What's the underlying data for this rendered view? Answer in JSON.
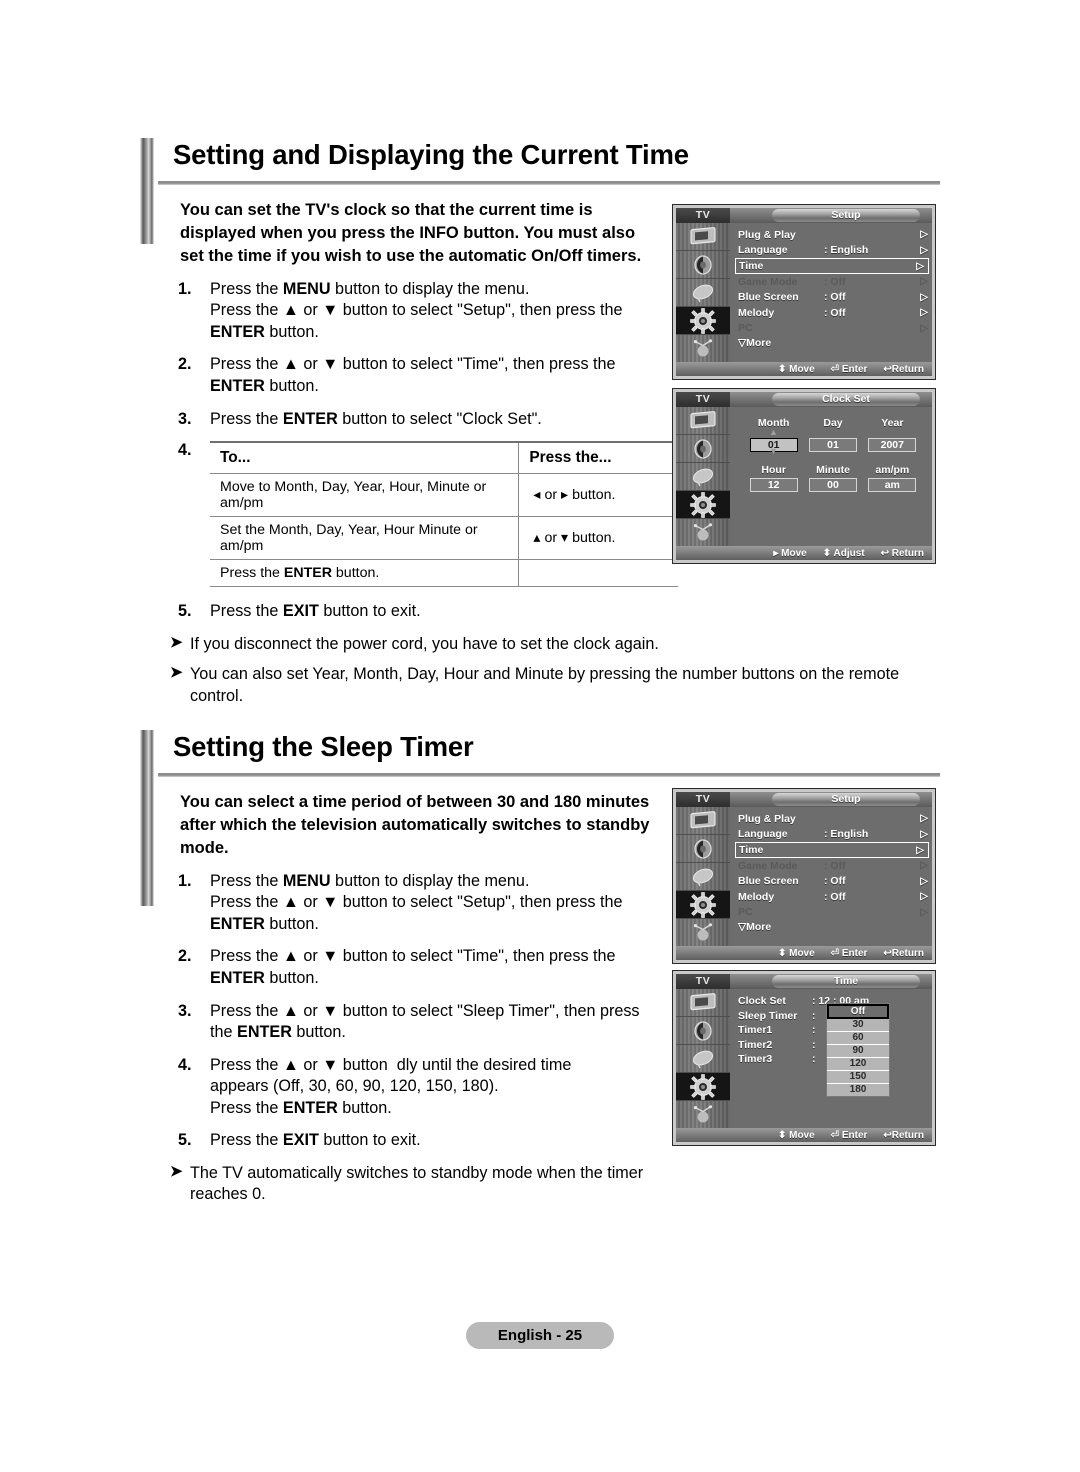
{
  "page": {
    "footer_label": "English - 25"
  },
  "section1": {
    "heading": "Setting and Displaying the Current Time",
    "intro": "You can set the TV's clock so that the current time is displayed when you press the INFO button. You must also set the time if you wish to use the automatic On/Off timers.",
    "steps": [
      {
        "num": "1.",
        "lines": [
          "Press the MENU button to display the menu.",
          "Press the ▲ or ▼ button to select \"Setup\", then press the ENTER button."
        ]
      },
      {
        "num": "2.",
        "lines": [
          "Press the ▲ or ▼ button to select \"Time\", then press the ENTER button."
        ]
      },
      {
        "num": "3.",
        "lines": [
          "Press the ENTER button to select \"Clock Set\"."
        ]
      }
    ],
    "table": {
      "num": "4.",
      "headers": [
        "To...",
        "Press the..."
      ],
      "rows": [
        [
          "Move to Month, Day, Year, Hour, Minute or am/pm",
          "◂  or  ▸  button."
        ],
        [
          "Set the Month, Day, Year, Hour Minute or am/pm",
          "▴  or  ▾  button."
        ],
        [
          "Press the ENTER button.",
          ""
        ]
      ]
    },
    "step5": {
      "num": "5.",
      "text": "Press the EXIT button to exit."
    },
    "notes": [
      "If you disconnect the power cord, you have to set the clock again.",
      "You can also set Year, Month, Day, Hour and Minute by pressing the number buttons on the remote control."
    ]
  },
  "section2": {
    "heading": "Setting the Sleep Timer",
    "intro": "You can select a time period of between 30 and 180 minutes after which the television automatically switches to standby mode.",
    "steps": [
      {
        "num": "1.",
        "lines": [
          "Press the MENU button to display the menu.",
          "Press the ▲ or ▼ button to select \"Setup\", then press the ENTER button."
        ]
      },
      {
        "num": "2.",
        "lines": [
          "Press the ▲ or ▼ button to select \"Time\", then press the ENTER button."
        ]
      },
      {
        "num": "3.",
        "lines": [
          "Press the ▲ or ▼ button to select \"Sleep Timer\", then press the ENTER button."
        ]
      },
      {
        "num": "4.",
        "lines": [
          "Press the ▲ or ▼ button  dly until the desired time appears (Off, 30, 60, 90, 120, 150, 180).",
          "Press the ENTER button."
        ]
      },
      {
        "num": "5.",
        "lines": [
          "Press the EXIT button to exit."
        ]
      }
    ],
    "notes": [
      "The TV automatically switches to standby mode when the timer reaches 0."
    ]
  },
  "osd": {
    "tv_label": "TV",
    "sidebar_icons": [
      "picture-icon",
      "sound-icon",
      "channel-icon",
      "setup-gear-icon",
      "input-icon"
    ],
    "setup_menu": {
      "title": "Setup",
      "rows": [
        {
          "label": "Plug & Play",
          "value": "",
          "arrow": "▷",
          "state": "normal"
        },
        {
          "label": "Language",
          "value": ": English",
          "arrow": "▷",
          "state": "normal"
        },
        {
          "label": "Time",
          "value": "",
          "arrow": "▷",
          "state": "highlighted"
        },
        {
          "label": "Game Mode",
          "value": ": Off",
          "arrow": "▷",
          "state": "dimmed"
        },
        {
          "label": "Blue Screen",
          "value": ": Off",
          "arrow": "▷",
          "state": "normal"
        },
        {
          "label": "Melody",
          "value": ": Off",
          "arrow": "▷",
          "state": "normal"
        },
        {
          "label": "PC",
          "value": "",
          "arrow": "▷",
          "state": "dimmed"
        }
      ],
      "more_label": "▽More",
      "footer": [
        "⬍ Move",
        "⏎ Enter",
        "↩Return"
      ]
    },
    "clock_set": {
      "title": "Clock Set",
      "row1_labels": [
        "Month",
        "Day",
        "Year"
      ],
      "row1_values": [
        "01",
        "01",
        "2007"
      ],
      "row2_labels": [
        "Hour",
        "Minute",
        "am/pm"
      ],
      "row2_values": [
        "12",
        "00",
        "am"
      ],
      "selected_field": "Month",
      "footer": [
        "▸ Move",
        "⬍ Adjust",
        "↩ Return"
      ]
    },
    "time_menu": {
      "title": "Time",
      "rows": [
        {
          "label": "Clock Set",
          "value": ": 12 : 00  am"
        },
        {
          "label": "Sleep Timer",
          "value": ":"
        },
        {
          "label": "Timer1",
          "value": ":"
        },
        {
          "label": "Timer2",
          "value": ":"
        },
        {
          "label": "Timer3",
          "value": ":"
        }
      ],
      "sleep_options": [
        "Off",
        "30",
        "60",
        "90",
        "120",
        "150",
        "180"
      ],
      "selected_option": "Off",
      "footer": [
        "⬍ Move",
        "⏎ Enter",
        "↩Return"
      ]
    }
  }
}
